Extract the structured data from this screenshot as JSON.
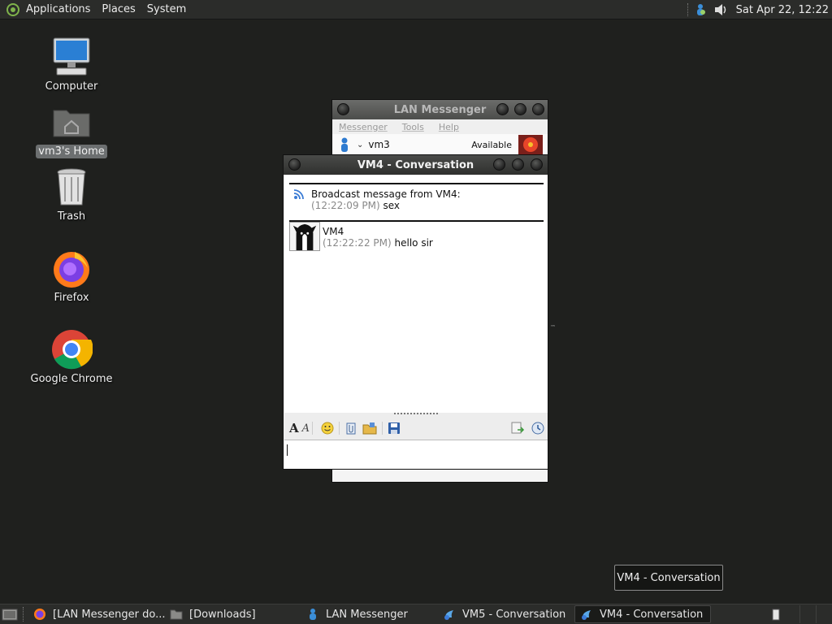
{
  "top_panel": {
    "menus": [
      "Applications",
      "Places",
      "System"
    ],
    "clock": "Sat Apr 22, 12:22"
  },
  "desktop": {
    "icons": [
      {
        "label": "Computer",
        "icon": "computer-icon"
      },
      {
        "label": "vm3's Home",
        "icon": "home-folder-icon"
      },
      {
        "label": "Trash",
        "icon": "trash-icon"
      },
      {
        "label": "Firefox",
        "icon": "firefox-icon"
      },
      {
        "label": "Google Chrome",
        "icon": "chrome-icon"
      }
    ]
  },
  "lan_messenger": {
    "title": "LAN Messenger",
    "menus": [
      "Messenger",
      "Tools",
      "Help"
    ],
    "user": "vm3",
    "status": "Available"
  },
  "conversation": {
    "title": "VM4 - Conversation",
    "broadcast": {
      "header": "Broadcast message from VM4:",
      "time": "(12:22:09 PM)",
      "text": "sex"
    },
    "message": {
      "sender": "VM4",
      "time": "(12:22:22 PM)",
      "text": "hello sir"
    },
    "toolbar_icons": [
      "font-icon",
      "font-color-icon",
      "smiley-icon",
      "attach-file-icon",
      "send-folder-icon",
      "save-icon",
      "history-icon",
      "buzz-icon"
    ]
  },
  "taskbar": {
    "tasks": [
      {
        "label": "[LAN Messenger do...",
        "icon": "firefox-icon"
      },
      {
        "label": "[Downloads]",
        "icon": "folder-icon"
      },
      {
        "label": "LAN Messenger",
        "icon": "messenger-icon"
      },
      {
        "label": "VM5 - Conversation",
        "icon": "messenger-icon"
      },
      {
        "label": "VM4 - Conversation",
        "icon": "messenger-icon"
      }
    ]
  },
  "tooltip": "VM4 - Conversation"
}
